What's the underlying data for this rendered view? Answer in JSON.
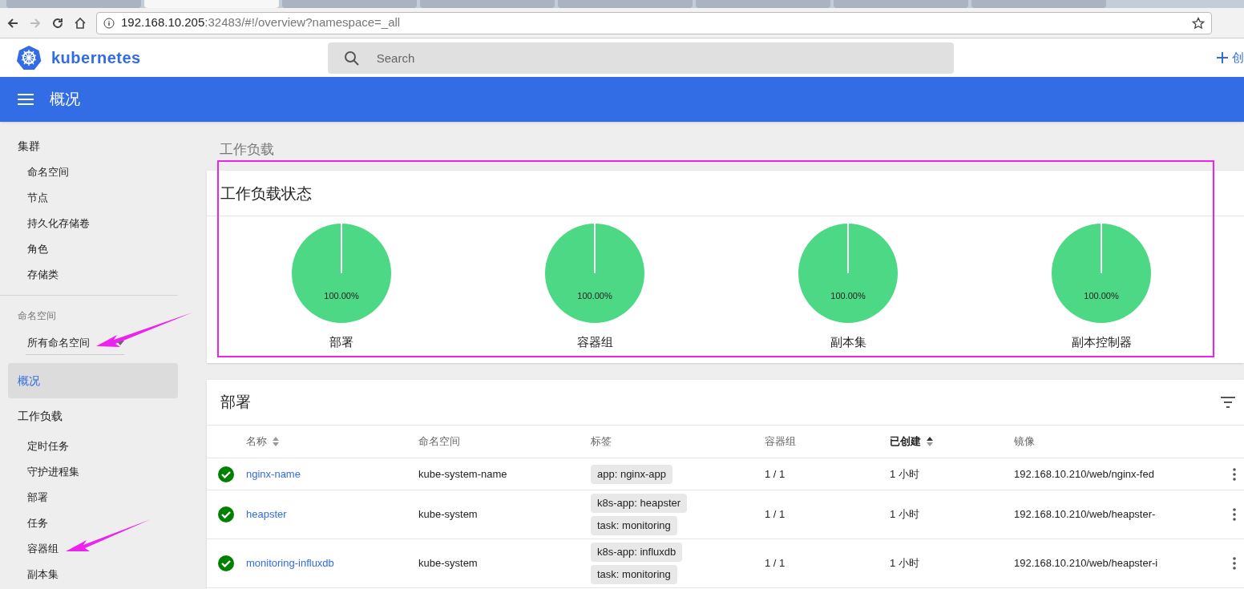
{
  "browser": {
    "tabs": [
      {
        "selected": false
      },
      {
        "selected": true
      },
      {
        "selected": false
      },
      {
        "selected": false
      },
      {
        "selected": false
      },
      {
        "selected": false
      },
      {
        "selected": false
      },
      {
        "selected": false
      }
    ],
    "url_host": "192.168.10.205",
    "url_path": ":32483/#!/overview?namespace=_all"
  },
  "header": {
    "logo": "kubernetes",
    "search": {
      "placeholder": "Search"
    },
    "create": "创"
  },
  "toolbar": {
    "title": "概况"
  },
  "sidebar": {
    "cluster": {
      "title": "集群",
      "items": [
        {
          "label": "命名空间"
        },
        {
          "label": "节点"
        },
        {
          "label": "持久化存储卷"
        },
        {
          "label": "角色"
        },
        {
          "label": "存储类"
        }
      ]
    },
    "namespace": {
      "label": "命名空间",
      "value": "所有命名空间"
    },
    "overview": {
      "label": "概况",
      "selected": true
    },
    "workloads": {
      "title": "工作负载",
      "items": [
        {
          "label": "定时任务"
        },
        {
          "label": "守护进程集"
        },
        {
          "label": "部署"
        },
        {
          "label": "任务"
        },
        {
          "label": "容器组"
        },
        {
          "label": "副本集"
        }
      ]
    }
  },
  "main": {
    "heading": "工作负载",
    "status_card": {
      "title": "工作负载状态",
      "charts": [
        {
          "chart_data": {
            "type": "pie",
            "title": "部署",
            "values": [
              100
            ],
            "data_labels": true,
            "value_labels": [
              "100.00%"
            ]
          }
        },
        {
          "chart_data": {
            "type": "pie",
            "title": "容器组",
            "values": [
              100
            ],
            "data_labels": true,
            "value_labels": [
              "100.00%"
            ]
          }
        },
        {
          "chart_data": {
            "type": "pie",
            "title": "副本集",
            "values": [
              100
            ],
            "data_labels": true,
            "value_labels": [
              "100.00%"
            ]
          }
        },
        {
          "chart_data": {
            "type": "pie",
            "title": "副本控制器",
            "values": [
              100
            ],
            "data_labels": true,
            "value_labels": [
              "100.00%"
            ]
          }
        }
      ]
    },
    "deployments": {
      "title": "部署",
      "columns": [
        {
          "label": "名称",
          "sortable": true,
          "sorted": false
        },
        {
          "label": "命名空间"
        },
        {
          "label": "标签"
        },
        {
          "label": "容器组"
        },
        {
          "label": "已创建",
          "sortable": true,
          "sorted": true
        },
        {
          "label": "镜像"
        }
      ],
      "rows": [
        {
          "healthy": true,
          "name": "nginx-name",
          "namespace": "kube-system-name",
          "labels": [
            "app: nginx-app"
          ],
          "pods": "1 / 1",
          "created": "1 小时",
          "image": "192.168.10.210/web/nginx-fed"
        },
        {
          "healthy": true,
          "name": "heapster",
          "namespace": "kube-system",
          "labels": [
            "k8s-app: heapster",
            "task: monitoring"
          ],
          "pods": "1 / 1",
          "created": "1 小时",
          "image": "192.168.10.210/web/heapster-"
        },
        {
          "healthy": true,
          "name": "monitoring-influxdb",
          "namespace": "kube-system",
          "labels": [
            "k8s-app: influxdb",
            "task: monitoring"
          ],
          "pods": "1 / 1",
          "created": "1 小时",
          "image": "192.168.10.210/web/heapster-i"
        }
      ]
    }
  }
}
